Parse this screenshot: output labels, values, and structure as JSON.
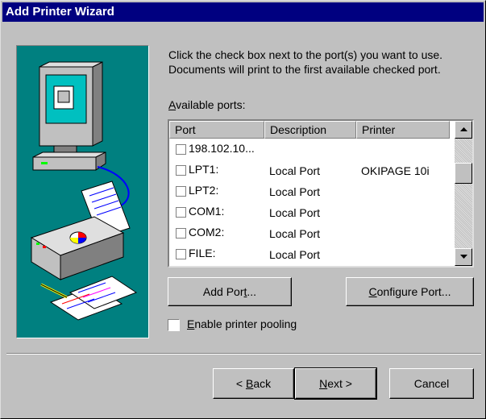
{
  "window": {
    "title": "Add Printer Wizard"
  },
  "instructions": "Click the check box next to the port(s) you want to use. Documents will print to the first available checked port.",
  "available_ports_label": {
    "mnemonic": "A",
    "rest": "vailable ports:"
  },
  "ports_table": {
    "columns": [
      "Port",
      "Description",
      "Printer"
    ],
    "rows": [
      {
        "port": "198.102.10...",
        "description": "",
        "printer": "",
        "checked": false
      },
      {
        "port": "LPT1:",
        "description": "Local Port",
        "printer": "OKIPAGE 10i",
        "checked": false
      },
      {
        "port": "LPT2:",
        "description": "Local Port",
        "printer": "",
        "checked": false
      },
      {
        "port": "COM1:",
        "description": "Local Port",
        "printer": "",
        "checked": false
      },
      {
        "port": "COM2:",
        "description": "Local Port",
        "printer": "",
        "checked": false
      },
      {
        "port": "FILE:",
        "description": "Local Port",
        "printer": "",
        "checked": false
      }
    ]
  },
  "buttons": {
    "add_port": {
      "pre": "Add Por",
      "mnemonic": "t",
      "post": "..."
    },
    "configure_port": {
      "pre": "",
      "mnemonic": "C",
      "post": "onfigure Port..."
    },
    "back": {
      "pre": "< ",
      "mnemonic": "B",
      "post": "ack"
    },
    "next": {
      "pre": "",
      "mnemonic": "N",
      "post": "ext >"
    },
    "cancel": {
      "label": "Cancel"
    }
  },
  "pooling": {
    "mnemonic": "E",
    "rest": "nable printer pooling",
    "checked": false
  },
  "icons": [
    "computer-icon",
    "printer-icon",
    "documents-icon",
    "scroll-up-icon",
    "scroll-down-icon"
  ],
  "colors": {
    "title_bar": "#000080",
    "dialog_face": "#c0c0c0",
    "art_background": "#008080"
  }
}
